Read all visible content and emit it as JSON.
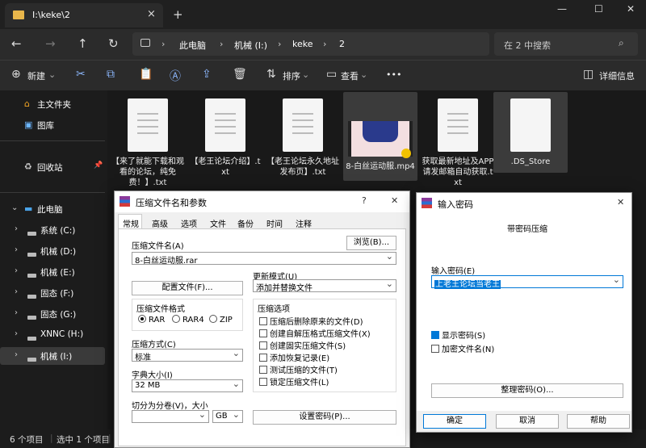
{
  "window": {
    "tab_title": "I:\\keke\\2",
    "close_tab": "×",
    "new_tab": "+",
    "minimize": "—",
    "maximize": "☐",
    "close": "✕"
  },
  "nav": {
    "back": "←",
    "forward": "→",
    "up": "↑",
    "refresh": "↻",
    "breadcrumb": [
      "此电脑",
      "机械 (I:)",
      "keke",
      "2"
    ],
    "search_placeholder": "在 2 中搜索"
  },
  "toolbar": {
    "new_label": "新建",
    "sort_label": "排序",
    "view_label": "查看",
    "more": "•••",
    "details_label": "详细信息"
  },
  "sidebar": {
    "items": [
      {
        "label": "主文件夹"
      },
      {
        "label": "图库"
      },
      {
        "label": "回收站"
      },
      {
        "label": "此电脑"
      },
      {
        "label": "系统 (C:)"
      },
      {
        "label": "机械 (D:)"
      },
      {
        "label": "机械 (E:)"
      },
      {
        "label": "固态 (F:)"
      },
      {
        "label": "固态 (G:)"
      },
      {
        "label": "XNNC (H:)"
      },
      {
        "label": "机械 (I:)"
      }
    ]
  },
  "files": [
    {
      "name": "【来了就能下载和观看的论坛，纯免费！】.txt"
    },
    {
      "name": "【老王论坛介绍】.txt"
    },
    {
      "name": "【老王论坛永久地址发布页】.txt"
    },
    {
      "name": "8-白丝运动服.mp4"
    },
    {
      "name": "获取最新地址及APP请发邮箱自动获取.txt"
    },
    {
      "name": ".DS_Store"
    }
  ],
  "status": {
    "count": "6 个项目",
    "selected": "选中 1 个项目"
  },
  "archive_dialog": {
    "title": "压缩文件名和参数",
    "help": "?",
    "close": "✕",
    "tabs": [
      "常规",
      "高级",
      "选项",
      "文件",
      "备份",
      "时间",
      "注释"
    ],
    "archive_name_label": "压缩文件名(A)",
    "browse_button": "浏览(B)...",
    "archive_name_value": "8-白丝运动服.rar",
    "update_mode_label": "更新模式(U)",
    "update_mode_value": "添加并替换文件",
    "profiles_button": "配置文件(F)...",
    "format_label": "压缩文件格式",
    "formats": [
      "RAR",
      "RAR4",
      "ZIP"
    ],
    "options_label": "压缩选项",
    "options": [
      "压缩后删除原来的文件(D)",
      "创建自解压格式压缩文件(X)",
      "创建固实压缩文件(S)",
      "添加恢复记录(E)",
      "测试压缩的文件(T)",
      "锁定压缩文件(L)"
    ],
    "method_label": "压缩方式(C)",
    "method_value": "标准",
    "dict_label": "字典大小(I)",
    "dict_value": "32 MB",
    "split_label": "切分为分卷(V)，大小",
    "split_unit": "GB",
    "set_password_button": "设置密码(P)..."
  },
  "password_dialog": {
    "title": "输入密码",
    "close": "✕",
    "subtitle": "带密码压缩",
    "enter_label": "输入密码(E)",
    "password_value": "上老王论坛当老王",
    "show_password": "显示密码(S)",
    "encrypt_names": "加密文件名(N)",
    "organize_button": "整理密码(O)...",
    "ok_button": "确定",
    "cancel_button": "取消",
    "help_button": "帮助"
  }
}
